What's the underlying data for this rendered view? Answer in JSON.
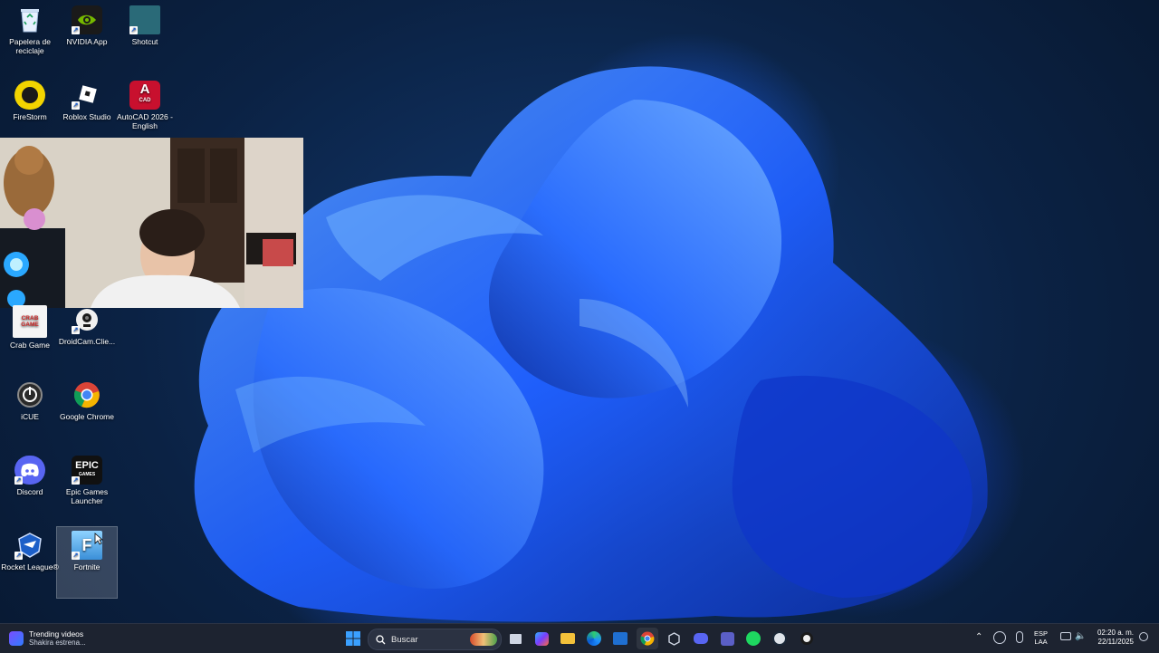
{
  "desktop": {
    "icons": [
      {
        "label": "Papelera de reciclaje",
        "icon": "recycle-bin-icon"
      },
      {
        "label": "NVIDIA App",
        "icon": "nvidia-icon"
      },
      {
        "label": "Shotcut",
        "icon": "shotcut-icon"
      },
      {
        "label": "FireStorm",
        "icon": "firestorm-icon"
      },
      {
        "label": "Roblox Studio",
        "icon": "roblox-studio-icon"
      },
      {
        "label": "AutoCAD 2026 - English",
        "icon": "autocad-icon"
      },
      {
        "label": "Crab Game",
        "icon": "crab-game-icon"
      },
      {
        "label": "DroidCam.Clie...",
        "icon": "droidcam-icon"
      },
      {
        "label": "iCUE",
        "icon": "icue-icon"
      },
      {
        "label": "Google Chrome",
        "icon": "chrome-icon"
      },
      {
        "label": "Discord",
        "icon": "discord-icon"
      },
      {
        "label": "Epic Games Launcher",
        "icon": "epic-games-icon"
      },
      {
        "label": "Rocket League®",
        "icon": "rocket-league-icon"
      },
      {
        "label": "Fortnite",
        "icon": "fortnite-icon"
      }
    ],
    "autocad_badge": "A",
    "autocad_sub": "CAD",
    "epic_badge": "EPIC",
    "epic_sub": "GAMES",
    "fortnite_badge": "F",
    "crab_badge": "CRAB GAME"
  },
  "taskbar": {
    "widget_title": "Trending videos",
    "widget_subtitle": "Shakira estrena...",
    "search_placeholder": "Buscar",
    "apps": [
      "start-icon",
      "search-icon",
      "widgets-game-icon",
      "file-explorer-icon",
      "copilot-icon",
      "folder-icon",
      "edge-icon",
      "outlook-icon",
      "chrome-icon",
      "unity-icon",
      "discord-icon",
      "teams-icon",
      "spotify-icon",
      "steam-icon",
      "droidcam-icon"
    ],
    "lang_top": "ESP",
    "lang_bottom": "LAA",
    "time": "02:20 a. m.",
    "date": "22/11/2025"
  },
  "colors": {
    "taskbar_bg": "#1d2330",
    "wallpaper_accent": "#1f5fff"
  }
}
